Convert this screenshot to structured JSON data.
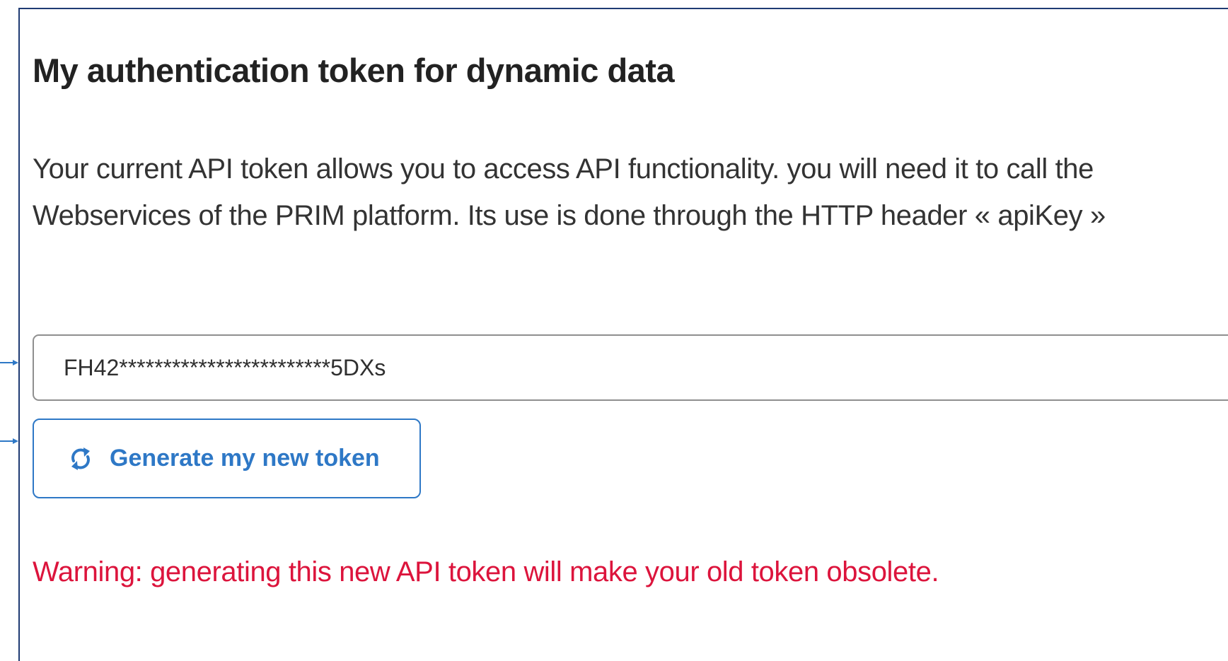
{
  "page": {
    "title": "My authentication token for dynamic data",
    "description": "Your current API token allows you to access API functionality. you will need it to call the Webservices of the PRIM platform. Its use is done through the HTTP header « apiKey »",
    "token": {
      "value": "FH42************************5DXs"
    },
    "generate_button": {
      "label": "Generate my new token",
      "icon": "refresh-icon"
    },
    "warning": "Warning: generating this new API token will make your old token obsolete."
  },
  "colors": {
    "primary": "#2e78c6",
    "warning": "#dc143c",
    "panel_border": "#1f3b73",
    "text": "#333333"
  }
}
